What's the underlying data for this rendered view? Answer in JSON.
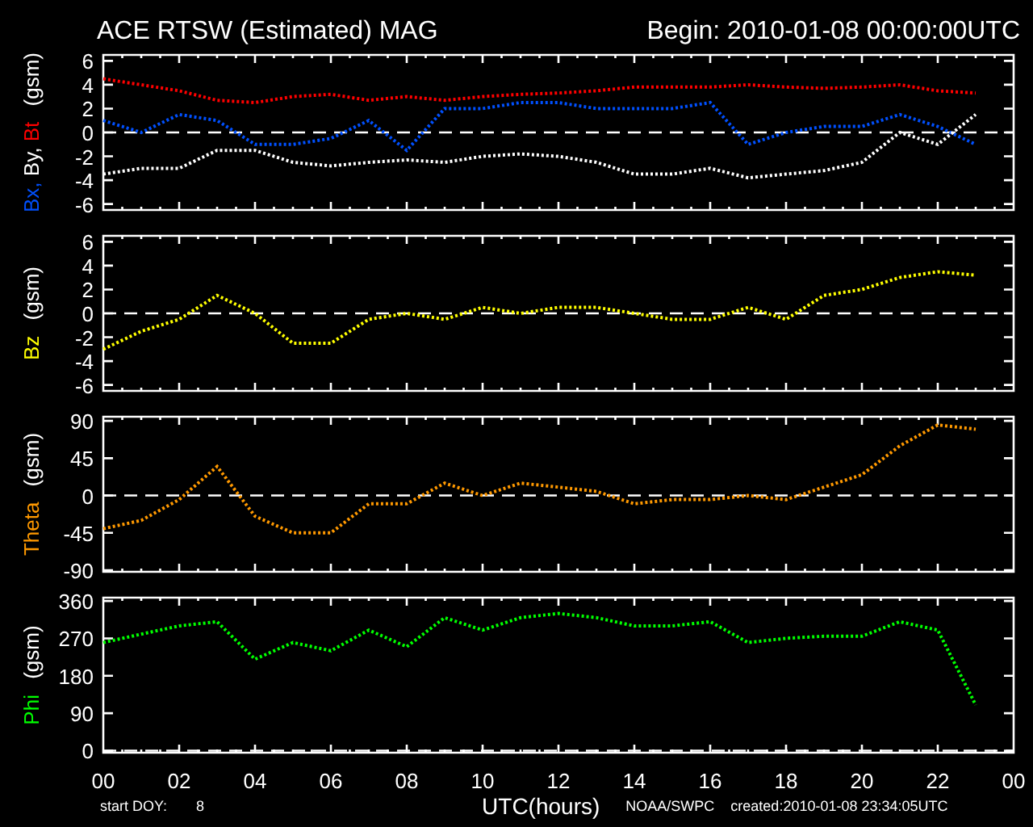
{
  "title": "ACE RTSW (Estimated) MAG",
  "begin": "Begin: 2010-01-08 00:00:00UTC",
  "panels": [
    {
      "chart_data": {
        "type": "line",
        "ylabel": "(gsm)",
        "x": [
          0,
          1,
          2,
          3,
          4,
          5,
          6,
          7,
          8,
          9,
          10,
          11,
          12,
          13,
          14,
          15,
          16,
          17,
          18,
          19,
          20,
          21,
          22,
          23
        ],
        "ylim": [
          -6.5,
          6.5
        ],
        "yticks": [
          -6,
          -4,
          -2,
          0,
          2,
          4,
          6
        ],
        "xlim": [
          0,
          24
        ],
        "series": [
          {
            "name": "Bx,",
            "color": "#0050ff",
            "line_style": "dotted",
            "values": [
              1,
              0,
              1.5,
              1,
              -1,
              -1,
              -0.5,
              1,
              -1.5,
              2,
              2,
              2.5,
              2.5,
              2,
              2,
              2,
              2.5,
              -1,
              0,
              0.5,
              0.5,
              1.5,
              0.5,
              -1
            ]
          },
          {
            "name": "By,",
            "color": "#ffffff",
            "line_style": "dotted",
            "values": [
              -3.5,
              -3,
              -3,
              -1.5,
              -1.5,
              -2.5,
              -2.8,
              -2.5,
              -2.3,
              -2.5,
              -2,
              -1.8,
              -2,
              -2.5,
              -3.5,
              -3.5,
              -3,
              -3.8,
              -3.5,
              -3.2,
              -2.5,
              0,
              -1,
              1.5
            ]
          },
          {
            "name": "Bt",
            "color": "#ff0000",
            "line_style": "dotted",
            "values": [
              4.5,
              4,
              3.5,
              2.7,
              2.5,
              3,
              3.2,
              2.7,
              3,
              2.7,
              3,
              3.2,
              3.3,
              3.5,
              3.8,
              3.8,
              3.8,
              4,
              3.8,
              3.7,
              3.8,
              4,
              3.5,
              3.3
            ]
          }
        ]
      }
    },
    {
      "chart_data": {
        "type": "line",
        "ylabel": "(gsm)",
        "x": [
          0,
          1,
          2,
          3,
          4,
          5,
          6,
          7,
          8,
          9,
          10,
          11,
          12,
          13,
          14,
          15,
          16,
          17,
          18,
          19,
          20,
          21,
          22,
          23
        ],
        "ylim": [
          -6.5,
          6.5
        ],
        "yticks": [
          -6,
          -4,
          -2,
          0,
          2,
          4,
          6
        ],
        "xlim": [
          0,
          24
        ],
        "series": [
          {
            "name": "Bz",
            "color": "#ffff00",
            "line_style": "dotted",
            "values": [
              -3,
              -1.5,
              -0.5,
              1.5,
              0,
              -2.5,
              -2.5,
              -0.5,
              0,
              -0.5,
              0.5,
              0,
              0.5,
              0.5,
              0,
              -0.5,
              -0.5,
              0.5,
              -0.5,
              1.5,
              2,
              3,
              3.5,
              3.2
            ]
          }
        ]
      }
    },
    {
      "chart_data": {
        "type": "line",
        "ylabel": "(gsm)",
        "x": [
          0,
          1,
          2,
          3,
          4,
          5,
          6,
          7,
          8,
          9,
          10,
          11,
          12,
          13,
          14,
          15,
          16,
          17,
          18,
          19,
          20,
          21,
          22,
          23
        ],
        "ylim": [
          -92,
          95
        ],
        "yticks": [
          -90,
          -45,
          0,
          45,
          90
        ],
        "xlim": [
          0,
          24
        ],
        "series": [
          {
            "name": "Theta",
            "color": "#ff9900",
            "line_style": "dotted",
            "values": [
              -40,
              -30,
              -5,
              35,
              -25,
              -45,
              -45,
              -10,
              -10,
              15,
              0,
              15,
              10,
              5,
              -10,
              -5,
              -5,
              0,
              -5,
              10,
              25,
              60,
              85,
              80
            ]
          }
        ]
      }
    },
    {
      "chart_data": {
        "type": "line",
        "ylabel": "(gsm)",
        "x": [
          0,
          1,
          2,
          3,
          4,
          5,
          6,
          7,
          8,
          9,
          10,
          11,
          12,
          13,
          14,
          15,
          16,
          17,
          18,
          19,
          20,
          21,
          22,
          23
        ],
        "ylim": [
          -5,
          368
        ],
        "yticks": [
          0,
          90,
          180,
          270,
          360
        ],
        "xlim": [
          0,
          24
        ],
        "xticks": [
          {
            "value": 0,
            "label": "00"
          },
          {
            "value": 2,
            "label": "02"
          },
          {
            "value": 4,
            "label": "04"
          },
          {
            "value": 6,
            "label": "06"
          },
          {
            "value": 8,
            "label": "08"
          },
          {
            "value": 10,
            "label": "10"
          },
          {
            "value": 12,
            "label": "12"
          },
          {
            "value": 14,
            "label": "14"
          },
          {
            "value": 16,
            "label": "16"
          },
          {
            "value": 18,
            "label": "18"
          },
          {
            "value": 20,
            "label": "20"
          },
          {
            "value": 22,
            "label": "22"
          },
          {
            "value": 24,
            "label": "00"
          }
        ],
        "series": [
          {
            "name": "Phi",
            "color": "#00ff00",
            "line_style": "dotted",
            "values": [
              260,
              280,
              300,
              310,
              220,
              260,
              240,
              290,
              250,
              320,
              290,
              320,
              330,
              320,
              300,
              300,
              310,
              260,
              270,
              275,
              275,
              310,
              290,
              110
            ]
          }
        ]
      }
    }
  ],
  "footer": {
    "doy_label": "start DOY:",
    "doy": "8",
    "xlabel": "UTC(hours)",
    "source": "NOAA/SWPC",
    "created": "created:2010-01-08 23:34:05UTC"
  }
}
